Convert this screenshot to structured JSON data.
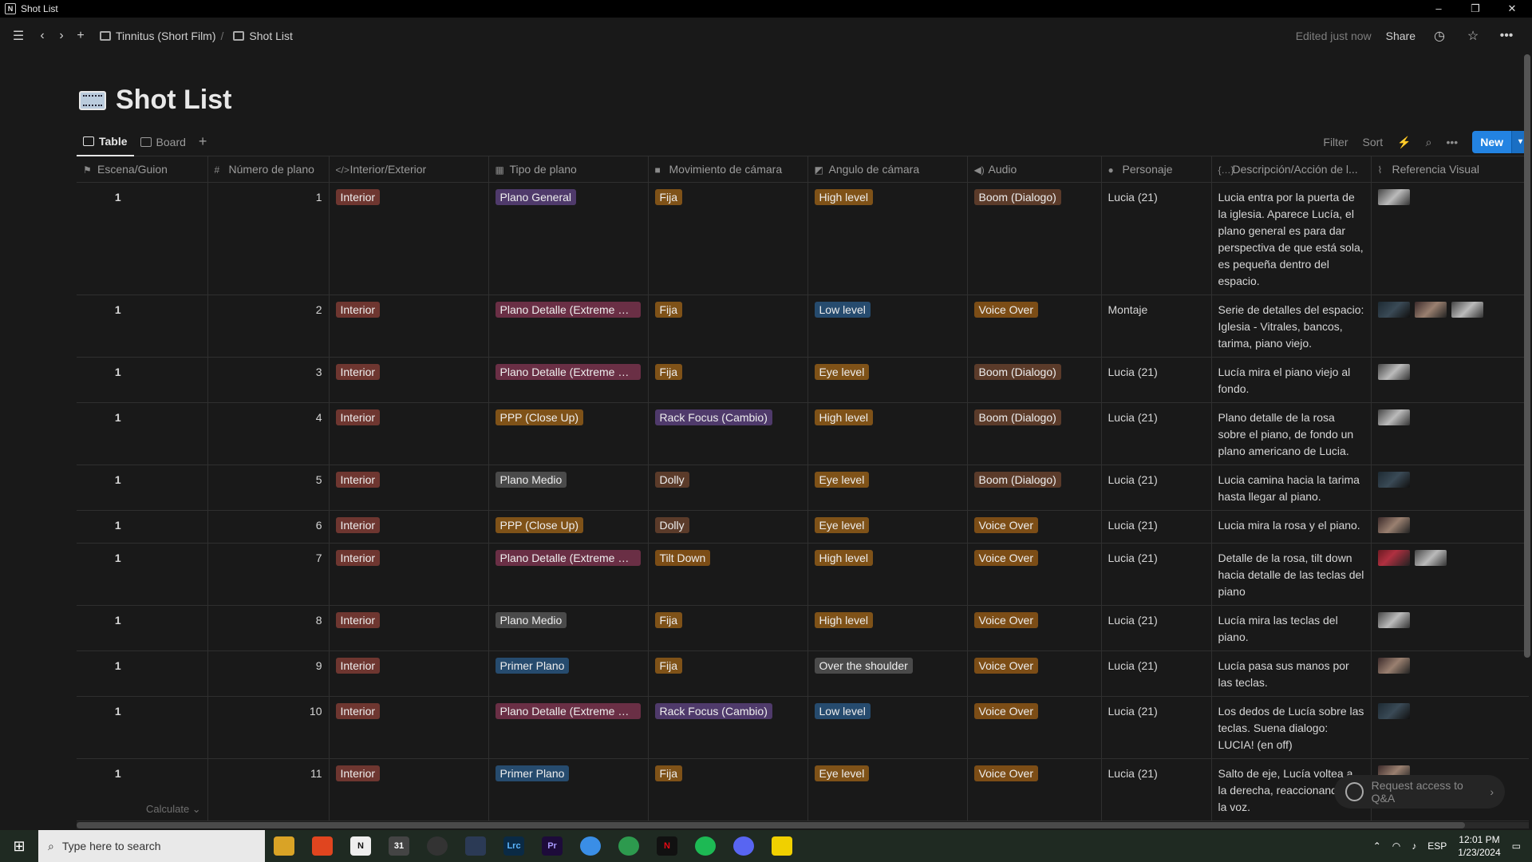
{
  "window": {
    "title": "Shot List",
    "min": "–",
    "max": "❐",
    "close": "✕"
  },
  "breadcrumb": {
    "parent": "Tinnitus (Short Film)",
    "separator": "/",
    "current": "Shot List"
  },
  "topbar": {
    "edited": "Edited just now",
    "share": "Share"
  },
  "page": {
    "title": "Shot List"
  },
  "views": {
    "tabs": [
      {
        "label": "Table"
      },
      {
        "label": "Board"
      }
    ],
    "add": "+"
  },
  "tools": {
    "filter": "Filter",
    "sort": "Sort",
    "new": "New"
  },
  "columns": [
    "Escena/Guion",
    "Número de plano",
    "Interior/Exterior",
    "Tipo de plano",
    "Movimiento de cámara",
    "Angulo de cámara",
    "Audio",
    "Personaje",
    "Descripción/Acción de l...",
    "Referencia Visual"
  ],
  "rows": [
    {
      "escena": "1",
      "numero": "1",
      "intext": "Interior",
      "tipo": "Plano General",
      "tipoColor": "purple",
      "mov": "Fija",
      "movColor": "orange",
      "angulo": "High level",
      "angColor": "orange",
      "audio": "Boom (Dialogo)",
      "audColor": "brown",
      "personaje": "Lucia (21)",
      "desc": "Lucia entra por la puerta de la iglesia. Aparece Lucía, el plano general es para dar perspectiva de que está sola, es pequeña dentro del espacio.",
      "thumbs": [
        "a"
      ]
    },
    {
      "escena": "1",
      "numero": "2",
      "intext": "Interior",
      "tipo": "Plano Detalle (Extreme Cl...",
      "tipoColor": "pink",
      "mov": "Fija",
      "movColor": "orange",
      "angulo": "Low level",
      "angColor": "blue",
      "audio": "Voice Over",
      "audColor": "dorange",
      "personaje": "Montaje",
      "desc": "Serie de detalles del espacio: Iglesia - Vitrales, bancos, tarima, piano viejo.",
      "thumbs": [
        "d",
        "b",
        "a"
      ]
    },
    {
      "escena": "1",
      "numero": "3",
      "intext": "Interior",
      "tipo": "Plano Detalle (Extreme Cl...",
      "tipoColor": "pink",
      "mov": "Fija",
      "movColor": "orange",
      "angulo": "Eye level",
      "angColor": "orange",
      "audio": "Boom (Dialogo)",
      "audColor": "brown",
      "personaje": "Lucia (21)",
      "desc": "Lucía mira el piano viejo al fondo.",
      "thumbs": [
        "a"
      ]
    },
    {
      "escena": "1",
      "numero": "4",
      "intext": "Interior",
      "tipo": "PPP (Close Up)",
      "tipoColor": "orange",
      "mov": "Rack Focus (Cambio)",
      "movColor": "purple",
      "angulo": "High level",
      "angColor": "orange",
      "audio": "Boom (Dialogo)",
      "audColor": "brown",
      "personaje": "Lucia (21)",
      "desc": "Plano detalle de la rosa sobre el piano, de fondo un plano americano de Lucia.",
      "thumbs": [
        "a"
      ]
    },
    {
      "escena": "1",
      "numero": "5",
      "intext": "Interior",
      "tipo": "Plano Medio",
      "tipoColor": "gray",
      "mov": "Dolly",
      "movColor": "brown",
      "angulo": "Eye level",
      "angColor": "orange",
      "audio": "Boom (Dialogo)",
      "audColor": "brown",
      "personaje": "Lucia (21)",
      "desc": "Lucia camina hacia la tarima hasta llegar al piano.",
      "thumbs": [
        "d"
      ]
    },
    {
      "escena": "1",
      "numero": "6",
      "intext": "Interior",
      "tipo": "PPP (Close Up)",
      "tipoColor": "orange",
      "mov": "Dolly",
      "movColor": "brown",
      "angulo": "Eye level",
      "angColor": "orange",
      "audio": "Voice Over",
      "audColor": "dorange",
      "personaje": "Lucia (21)",
      "desc": "Lucia mira la rosa y el piano.",
      "thumbs": [
        "b"
      ]
    },
    {
      "escena": "1",
      "numero": "7",
      "intext": "Interior",
      "tipo": "Plano Detalle (Extreme Cl...",
      "tipoColor": "pink",
      "mov": "Tilt Down",
      "movColor": "dorange",
      "angulo": "High level",
      "angColor": "orange",
      "audio": "Voice Over",
      "audColor": "dorange",
      "personaje": "Lucia (21)",
      "desc": "Detalle de la rosa, tilt down hacia detalle de las teclas del piano",
      "thumbs": [
        "c",
        "a"
      ]
    },
    {
      "escena": "1",
      "numero": "8",
      "intext": "Interior",
      "tipo": "Plano Medio",
      "tipoColor": "gray",
      "mov": "Fija",
      "movColor": "orange",
      "angulo": "High level",
      "angColor": "orange",
      "audio": "Voice Over",
      "audColor": "dorange",
      "personaje": "Lucia (21)",
      "desc": "Lucía mira las teclas del piano.",
      "thumbs": [
        "a"
      ]
    },
    {
      "escena": "1",
      "numero": "9",
      "intext": "Interior",
      "tipo": "Primer Plano",
      "tipoColor": "blue",
      "mov": "Fija",
      "movColor": "orange",
      "angulo": "Over the shoulder",
      "angColor": "gray",
      "audio": "Voice Over",
      "audColor": "dorange",
      "personaje": "Lucia (21)",
      "desc": "Lucía pasa sus manos por las teclas.",
      "thumbs": [
        "b"
      ]
    },
    {
      "escena": "1",
      "numero": "10",
      "intext": "Interior",
      "tipo": "Plano Detalle (Extreme Cl...",
      "tipoColor": "pink",
      "mov": "Rack Focus (Cambio)",
      "movColor": "purple",
      "angulo": "Low level",
      "angColor": "blue",
      "audio": "Voice Over",
      "audColor": "dorange",
      "personaje": "Lucia (21)",
      "desc": "Los dedos de Lucía sobre las teclas. Suena dialogo: LUCIA! (en off)",
      "thumbs": [
        "d"
      ]
    },
    {
      "escena": "1",
      "numero": "11",
      "intext": "Interior",
      "tipo": "Primer Plano",
      "tipoColor": "blue",
      "mov": "Fija",
      "movColor": "orange",
      "angulo": "Eye level",
      "angColor": "orange",
      "audio": "Voice Over",
      "audColor": "dorange",
      "personaje": "Lucia (21)",
      "desc": "Salto de eje, Lucía voltea a la derecha, reaccionando a la voz.",
      "thumbs": [
        "b"
      ]
    }
  ],
  "footer": {
    "calculate": "Calculate ⌄"
  },
  "qa": {
    "label": "Request access to Q&A"
  },
  "taskbar": {
    "search_placeholder": "Type here to search",
    "lang": "ESP",
    "time": "12:01 PM",
    "date": "1/23/2024"
  }
}
